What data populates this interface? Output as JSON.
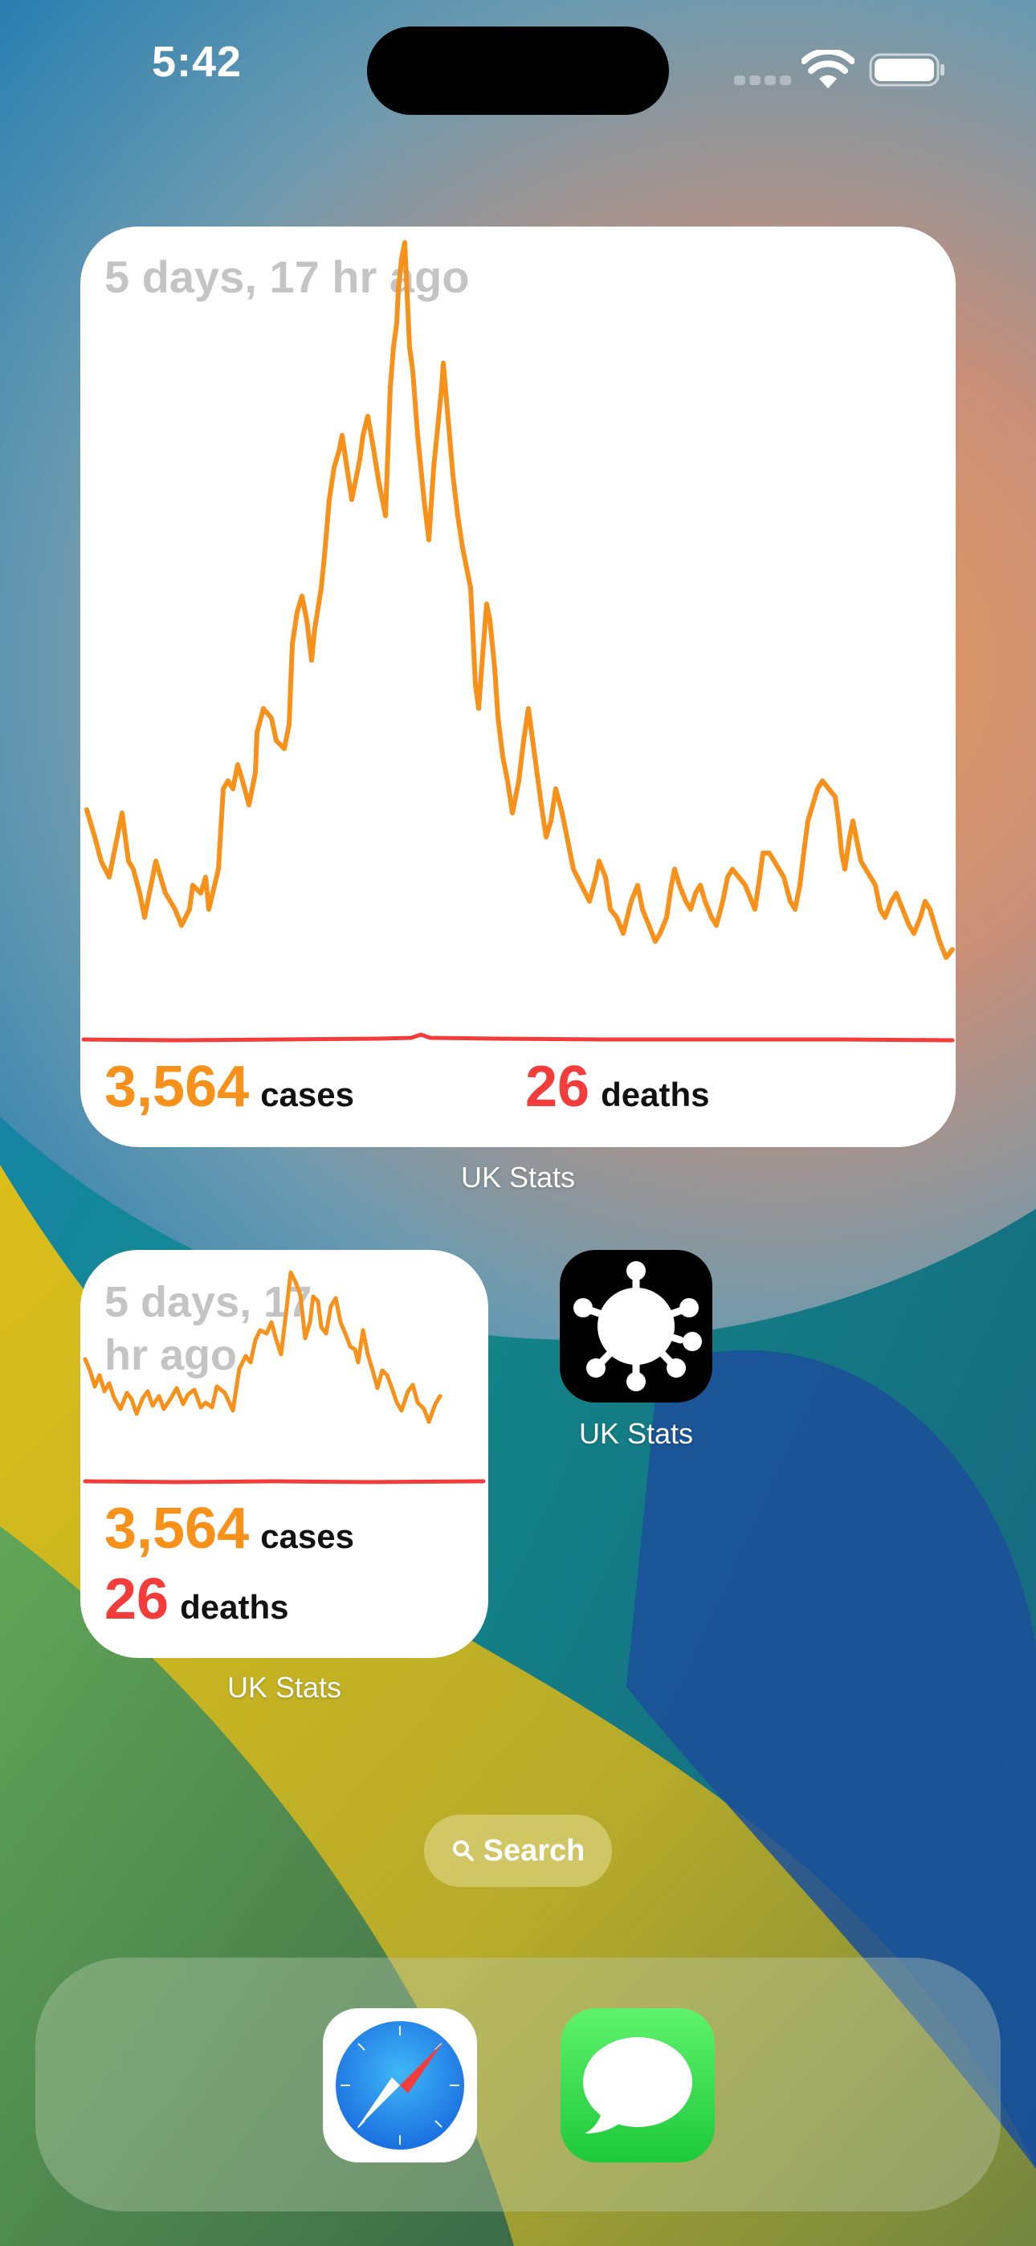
{
  "status_bar": {
    "time": "5:42"
  },
  "widgets": {
    "large": {
      "updated": "5 days, 17 hr ago",
      "cases_value": "3,564",
      "cases_label": "cases",
      "deaths_value": "26",
      "deaths_label": "deaths",
      "app_label": "UK Stats"
    },
    "small": {
      "updated": "5 days, 17 hr ago",
      "cases_value": "3,564",
      "cases_label": "cases",
      "deaths_value": "26",
      "deaths_label": "deaths",
      "app_label": "UK Stats"
    }
  },
  "app_icon": {
    "label": "UK Stats",
    "icon": "virus-icon"
  },
  "search": {
    "label": "Search",
    "icon": "magnifier-icon"
  },
  "dock": {
    "apps": [
      {
        "name": "Safari",
        "icon": "safari-compass-icon"
      },
      {
        "name": "Messages",
        "icon": "speech-bubble-icon"
      }
    ]
  },
  "colors": {
    "cases": "#f7911a",
    "deaths": "#f43d3a",
    "updated_text": "#c4c4c4"
  }
}
